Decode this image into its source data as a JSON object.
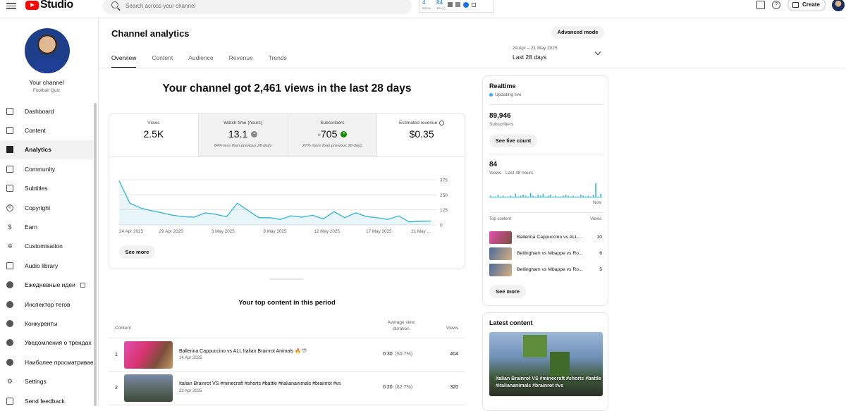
{
  "app": {
    "name": "Studio"
  },
  "search": {
    "placeholder": "Search across your channel"
  },
  "extension": {
    "n1": "4",
    "n1_sub": "60сек",
    "n2": "84",
    "n2_sub": "48ч(с)"
  },
  "topbar": {
    "create_label": "Create",
    "help_glyph": "?"
  },
  "sidebar": {
    "channel_name": "Your channel",
    "channel_sub": "Football Quiz",
    "items": [
      {
        "label": "Dashboard",
        "icon": "dashboard-icon"
      },
      {
        "label": "Content",
        "icon": "content-icon"
      },
      {
        "label": "Analytics",
        "icon": "analytics-icon"
      },
      {
        "label": "Community",
        "icon": "community-icon"
      },
      {
        "label": "Subtitles",
        "icon": "subtitles-icon"
      },
      {
        "label": "Copyright",
        "icon": "copyright-icon",
        "glyph": "©"
      },
      {
        "label": "Earn",
        "icon": "earn-icon",
        "glyph": "$"
      },
      {
        "label": "Customisation",
        "icon": "customisation-icon",
        "glyph": "✲"
      },
      {
        "label": "Audio library",
        "icon": "audio-library-icon"
      },
      {
        "label": "Ежедневные идеи",
        "icon": "extension-icon"
      },
      {
        "label": "Инспектор тегов",
        "icon": "extension-icon"
      },
      {
        "label": "Конкуренты",
        "icon": "extension-icon"
      },
      {
        "label": "Уведомления о трендах",
        "icon": "extension-icon"
      },
      {
        "label": "Наиболее просматриваемые",
        "icon": "extension-icon"
      },
      {
        "label": "Settings",
        "icon": "settings-icon",
        "glyph": "⚙"
      },
      {
        "label": "Send feedback",
        "icon": "feedback-icon"
      }
    ]
  },
  "page": {
    "title": "Channel analytics",
    "tabs": [
      "Overview",
      "Content",
      "Audience",
      "Revenue",
      "Trends"
    ],
    "advanced_mode": "Advanced mode",
    "date_range": "24 Apr – 21 May 2025",
    "date_label": "Last 28 days",
    "headline": "Your channel got 2,461 views in the last 28 days"
  },
  "metrics": [
    {
      "label": "Views",
      "value": "2.5K",
      "note": ""
    },
    {
      "label": "Watch time (hours)",
      "value": "13.1",
      "note": "84% less than previous 28 days",
      "badge": "gray",
      "badge_glyph": "−"
    },
    {
      "label": "Subscribers",
      "value": "-705",
      "note": "27% more than previous 28 days",
      "badge": "green",
      "badge_glyph": "+"
    },
    {
      "label": "Estimated revenue",
      "value": "$0.35",
      "note": ""
    }
  ],
  "chart_data": {
    "type": "line",
    "x_ticks": [
      "24 Apr 2025",
      "29 Apr 2025",
      "3 May 2025",
      "8 May 2025",
      "12 May 2025",
      "17 May 2025",
      "21 May ..."
    ],
    "y_ticks": [
      375,
      250,
      125,
      0
    ],
    "ylim": [
      0,
      375
    ],
    "values": [
      365,
      180,
      140,
      118,
      100,
      80,
      68,
      65,
      100,
      88,
      68,
      180,
      120,
      60,
      60,
      45,
      75,
      65,
      80,
      50,
      110,
      60,
      100,
      70,
      60,
      45,
      75,
      25,
      30,
      32
    ],
    "color": "#3eb8d4"
  },
  "chart": {
    "see_more": "See more"
  },
  "top_content": {
    "title": "Your top content in this period",
    "headers": {
      "content": "Content",
      "duration": "Average view duration",
      "views": "Views"
    },
    "rows": [
      {
        "rank": "1",
        "title": "Ballerina Cappuccino vs ALL Italian Brainrot Animals 🔥🦈",
        "date": "14 Apr 2025",
        "duration": "0:30",
        "pct": "(50.7%)",
        "views": "404"
      },
      {
        "rank": "2",
        "title": "Italian Brainrot VS #minecraft #shorts #battle #italiananimals #brainrot #vs",
        "date": "23 Apr 2025",
        "duration": "0:20",
        "pct": "(62.7%)",
        "views": "320"
      }
    ]
  },
  "realtime": {
    "title": "Realtime",
    "live": "Updating live",
    "subs": "89,946",
    "subs_label": "Subscribers",
    "see_live": "See live count",
    "views": "84",
    "views_label": "Views · Last 48 hours",
    "now": "Now",
    "bars": [
      2,
      1,
      1,
      3,
      1,
      2,
      1,
      1,
      2,
      1,
      4,
      1,
      2,
      3,
      2,
      1,
      5,
      2,
      1,
      3,
      2,
      4,
      1,
      2,
      3,
      1,
      2,
      1,
      1,
      2,
      3,
      2,
      1,
      2,
      1,
      1,
      3,
      2,
      1,
      2,
      1,
      3,
      16,
      1,
      4
    ],
    "top_label": "Top content",
    "views_col": "Views",
    "items": [
      {
        "title": "Ballerina Cappuccino vs ALL...",
        "views": "10"
      },
      {
        "title": "Bellingham vs Mbappe vs Ro...",
        "views": "6"
      },
      {
        "title": "Bellingham vs Mbappe vs Ro...",
        "views": "5"
      }
    ],
    "see_more": "See more"
  },
  "latest": {
    "title": "Latest content",
    "caption": "Italian Brainrot VS #minecraft #shorts #battle #italiananimals #brainrot #vs"
  }
}
